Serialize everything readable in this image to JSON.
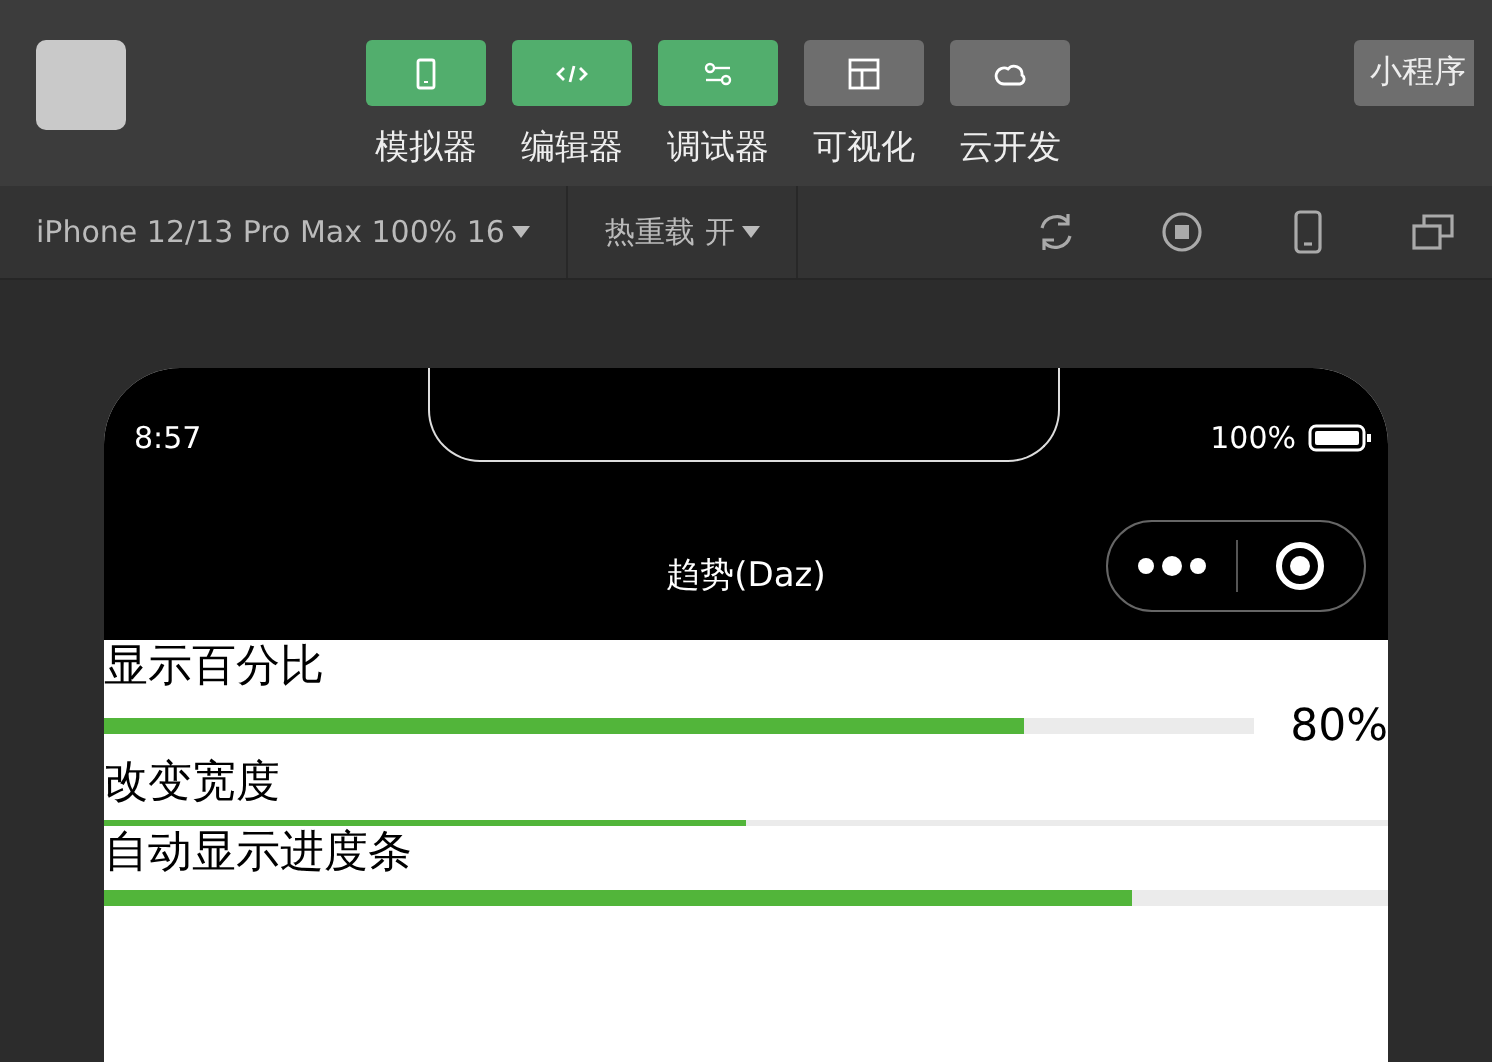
{
  "toolbar": {
    "tools": [
      {
        "label": "模拟器",
        "active": true,
        "kind": "phone"
      },
      {
        "label": "编辑器",
        "active": true,
        "kind": "code"
      },
      {
        "label": "调试器",
        "active": true,
        "kind": "sliders"
      },
      {
        "label": "可视化",
        "active": false,
        "kind": "layout"
      },
      {
        "label": "云开发",
        "active": false,
        "kind": "cloud"
      }
    ],
    "right_button": "小程序"
  },
  "sim_bar": {
    "device": "iPhone 12/13 Pro Max 100% 16",
    "hot_reload": "热重载 开"
  },
  "phone": {
    "time": "8:57",
    "battery": "100%",
    "title": "趋势(Daz)"
  },
  "progress": [
    {
      "label": "显示百分比",
      "level": 0.8,
      "kind": "thick",
      "percent": "80%"
    },
    {
      "label": "改变宽度",
      "level": 0.5,
      "kind": "thin"
    },
    {
      "label": "自动显示进度条",
      "level": 0.8,
      "kind": "thick"
    }
  ]
}
